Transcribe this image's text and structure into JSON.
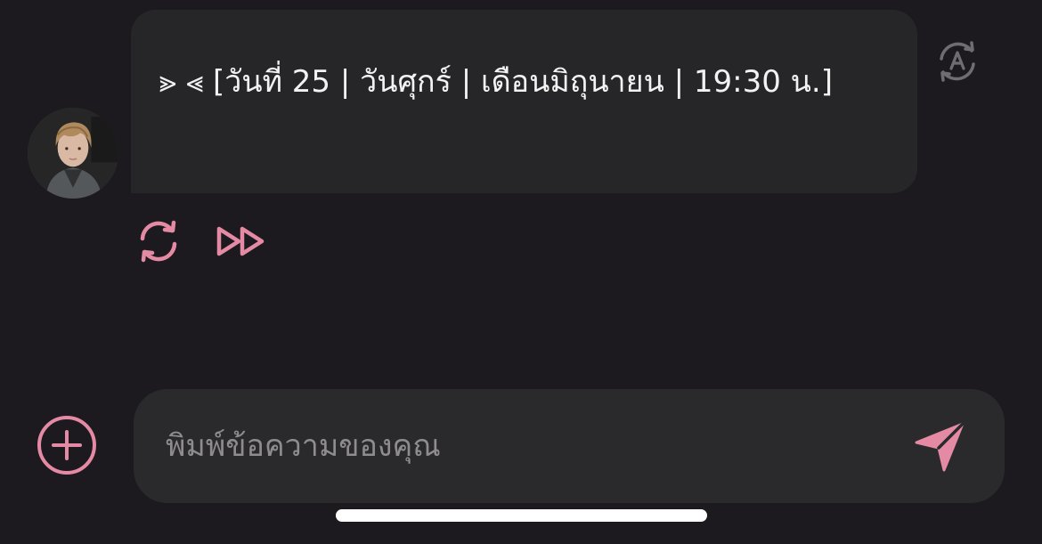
{
  "message": {
    "text": "⪢ ⪡ [วันที่ 25 | วันศุกร์ | เดือนมิถุนายน | 19:30 น.]"
  },
  "composer": {
    "placeholder": "พิมพ์ข้อความของคุณ"
  },
  "icons": {
    "translate": "translate-icon",
    "regenerate": "refresh-icon",
    "skip": "fast-forward-icon",
    "add": "plus-circle-icon",
    "send": "send-icon"
  },
  "colors": {
    "background": "#1c1a1f",
    "bubble": "#262628",
    "composer": "#2a2a2c",
    "accent": "#e58aa4",
    "muted_icon": "#6e6d72",
    "text": "#f2f2f2",
    "placeholder": "#8e8c91"
  }
}
